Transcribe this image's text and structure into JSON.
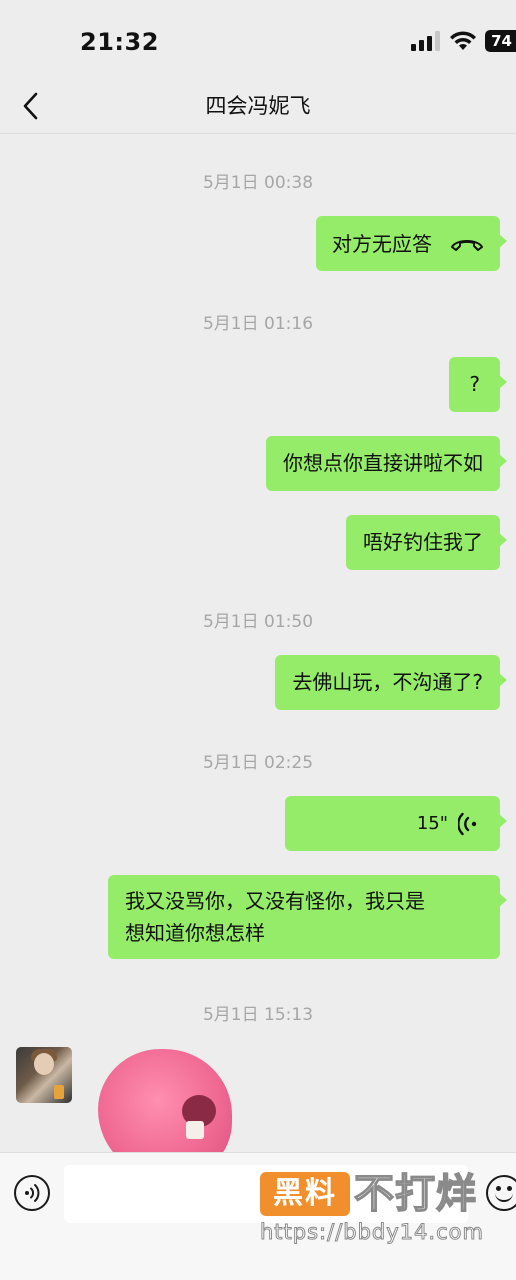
{
  "status_bar": {
    "time": "21:32",
    "battery": "74"
  },
  "nav": {
    "title": "四会冯妮飞"
  },
  "messages": {
    "ts1": "5月1日 00:38",
    "call_status": "对方无应答",
    "ts2": "5月1日 01:16",
    "msg_question": "?",
    "msg_2": "你想点你直接讲啦不如",
    "msg_3": "唔好钓住我了",
    "ts3": "5月1日 01:50",
    "msg_4": "去佛山玩，不沟通了?",
    "ts4": "5月1日 02:25",
    "voice_duration": "15\"",
    "msg_5_line1": "我又没骂你，又没有怪你，我只是",
    "msg_5_line2": "想知道你想怎样",
    "ts5": "5月1日 15:13"
  },
  "icons": {
    "back": "chevron-left-icon",
    "call": "phone-hangup-icon",
    "voice": "voice-wave-icon",
    "voice_toggle": "voice-input-icon",
    "emoji": "emoji-icon"
  },
  "colors": {
    "bubble_self": "#95ec69",
    "background": "#ededed",
    "timestamp": "#a6a6a6"
  },
  "watermark": {
    "badge": "黑料",
    "text": "不打烊",
    "url": "https://bbdy14.com"
  }
}
